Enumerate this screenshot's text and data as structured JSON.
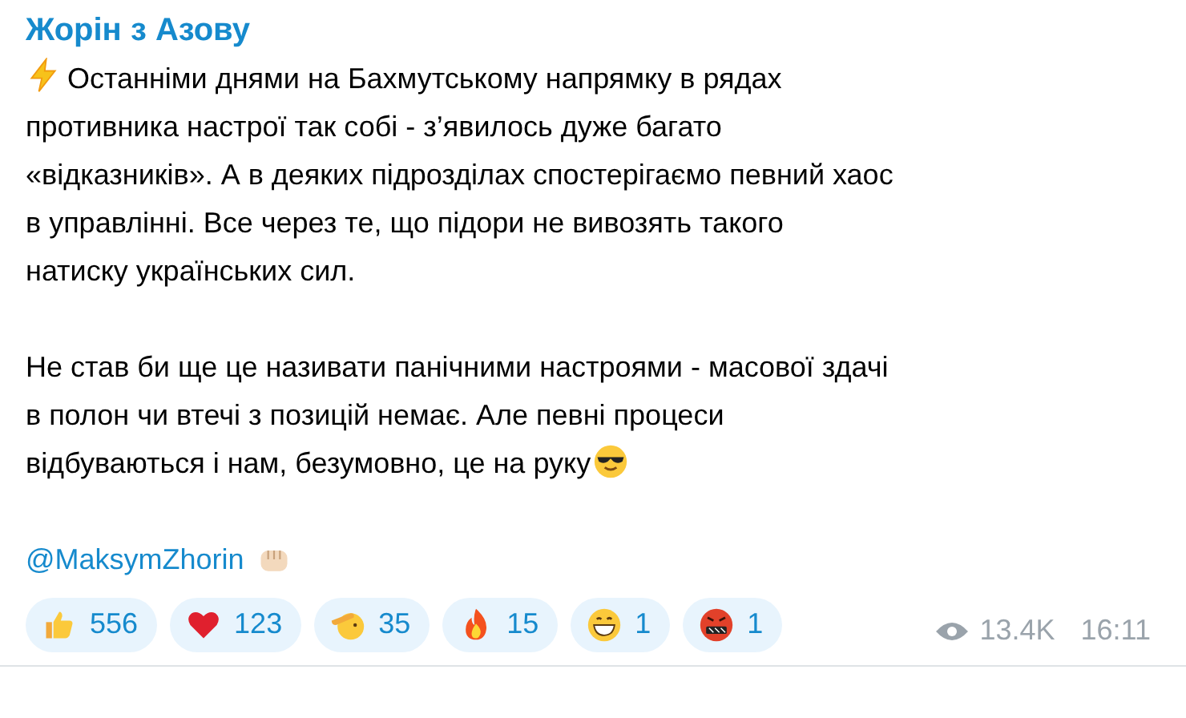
{
  "post": {
    "author": "Жорін з Азову",
    "paragraphs": [
      {
        "kind": "alert",
        "lines": [
          "Останніми днями на Бахмутському напрямку в рядах",
          "противника настрої так собі - з’явилось дуже багато",
          "«відказників». А в деяких підрозділах спостерігаємо певний хаос",
          "в управлінні. Все через те, що підори не вивозять такого",
          "натиску українських сил."
        ]
      },
      {
        "kind": "closing",
        "lines": [
          "Не став би ще це називати панічними настроями - масової здачі",
          "в полон чи втечі з позицій немає. Але певні процеси",
          "відбуваються і нам, безумовно, це на руку"
        ]
      }
    ],
    "signature": {
      "link": "@MaksymZhorin"
    },
    "reactions": [
      {
        "kind": "thumbs",
        "count": "556"
      },
      {
        "kind": "heart",
        "count": "123"
      },
      {
        "kind": "salute",
        "count": "35"
      },
      {
        "kind": "fire",
        "count": "15"
      },
      {
        "kind": "grin",
        "count": "1"
      },
      {
        "kind": "angry",
        "count": "1"
      }
    ],
    "views": "13.4K",
    "time": "16:11"
  }
}
